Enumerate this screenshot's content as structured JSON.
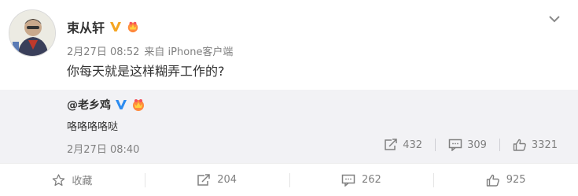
{
  "post": {
    "author": "束从轩",
    "date": "2月27日 08:52",
    "source": "来自 iPhone客户端",
    "text": "你每天就是这样糊弄工作的?"
  },
  "repost": {
    "author": "@老乡鸡",
    "text": "咯咯咯咯哒",
    "time": "2月27日 08:40",
    "forward_count": "432",
    "comment_count": "309",
    "like_count": "3321"
  },
  "actions": {
    "favorite_label": "收藏",
    "forward_count": "204",
    "comment_count": "262",
    "like_count": "925"
  },
  "colors": {
    "verified_gold": "#f5a623",
    "verified_blue": "#2d8cf0",
    "repost_bg": "#f2f2f5",
    "muted_text": "#808080"
  }
}
